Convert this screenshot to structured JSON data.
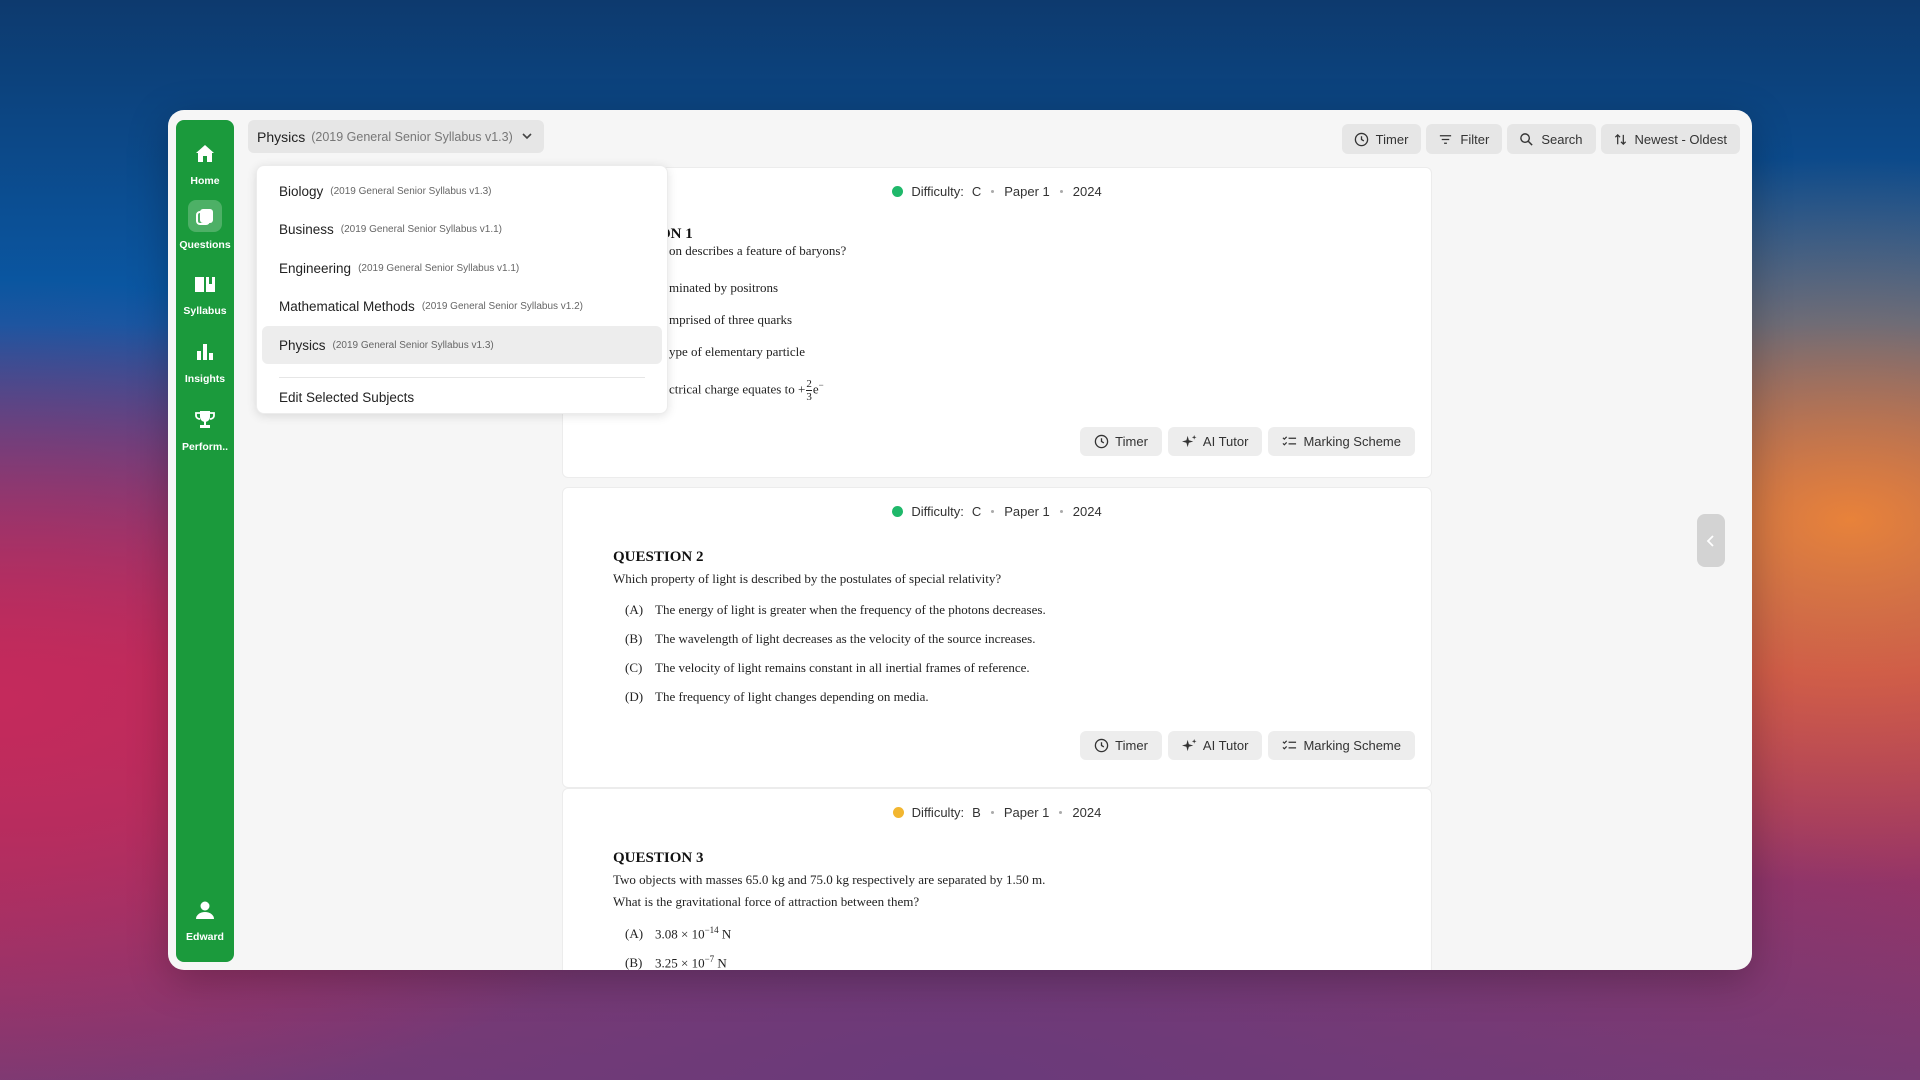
{
  "sidebar": {
    "items": [
      {
        "label": "Home",
        "icon": "home-icon"
      },
      {
        "label": "Questions",
        "icon": "questions-icon"
      },
      {
        "label": "Syllabus",
        "icon": "book-icon"
      },
      {
        "label": "Insights",
        "icon": "bar-chart-icon"
      },
      {
        "label": "Perform..",
        "icon": "trophy-icon"
      }
    ],
    "user": {
      "label": "Edward",
      "icon": "user-icon"
    },
    "accent": "#1b9a3c"
  },
  "subject_selector": {
    "name": "Physics",
    "version": "(2019 General Senior Syllabus v1.3)"
  },
  "toolbar": {
    "timer": "Timer",
    "filter": "Filter",
    "search": "Search",
    "sort": "Newest - Oldest"
  },
  "dropdown": {
    "items": [
      {
        "name": "Biology",
        "version": "(2019 General Senior Syllabus v1.3)"
      },
      {
        "name": "Business",
        "version": "(2019 General Senior Syllabus v1.1)"
      },
      {
        "name": "Engineering",
        "version": "(2019 General Senior Syllabus v1.1)"
      },
      {
        "name": "Mathematical Methods",
        "version": "(2019 General Senior Syllabus v1.2)"
      },
      {
        "name": "Physics",
        "version": "(2019 General Senior Syllabus v1.3)"
      }
    ],
    "selected": "Physics",
    "edit_label": "Edit Selected Subjects"
  },
  "questions": [
    {
      "difficulty_label": "Difficulty:",
      "difficulty": "C",
      "difficulty_color": "#1fb86a",
      "paper": "Paper 1",
      "year": "2024",
      "title": "ON 1",
      "stem": "on describes a feature of baryons?",
      "options": [
        "minated by positrons",
        "mprised of three quarks",
        "ype of elementary particle",
        "ctrical charge equates to +"
      ]
    },
    {
      "difficulty_label": "Difficulty:",
      "difficulty": "C",
      "difficulty_color": "#1fb86a",
      "paper": "Paper 1",
      "year": "2024",
      "title": "QUESTION 2",
      "stem": "Which property of light is described by the postulates of special relativity?",
      "options": [
        {
          "letter": "(A)",
          "text": "The energy of light is greater when the frequency of the photons decreases."
        },
        {
          "letter": "(B)",
          "text": "The wavelength of light decreases as the velocity of the source increases."
        },
        {
          "letter": "(C)",
          "text": "The velocity of light remains constant in all inertial frames of reference."
        },
        {
          "letter": "(D)",
          "text": "The frequency of light changes depending on media."
        }
      ]
    },
    {
      "difficulty_label": "Difficulty:",
      "difficulty": "B",
      "difficulty_color": "#f2b630",
      "paper": "Paper 1",
      "year": "2024",
      "title": "QUESTION 3",
      "stem1": "Two objects with masses 65.0 kg and 75.0 kg respectively are separated by 1.50 m.",
      "stem2": "What is the gravitational force of attraction between them?",
      "options": [
        {
          "letter": "(A)",
          "base": "3.08 × 10",
          "exp": "−14",
          "unit": " N"
        },
        {
          "letter": "(B)",
          "base": "3.25 × 10",
          "exp": "−7",
          "unit": " N"
        }
      ]
    }
  ],
  "card_actions": {
    "timer": "Timer",
    "ai_tutor": "AI Tutor",
    "marking_scheme": "Marking Scheme"
  },
  "fraction": {
    "num": "2",
    "den": "3",
    "tail": "e"
  }
}
